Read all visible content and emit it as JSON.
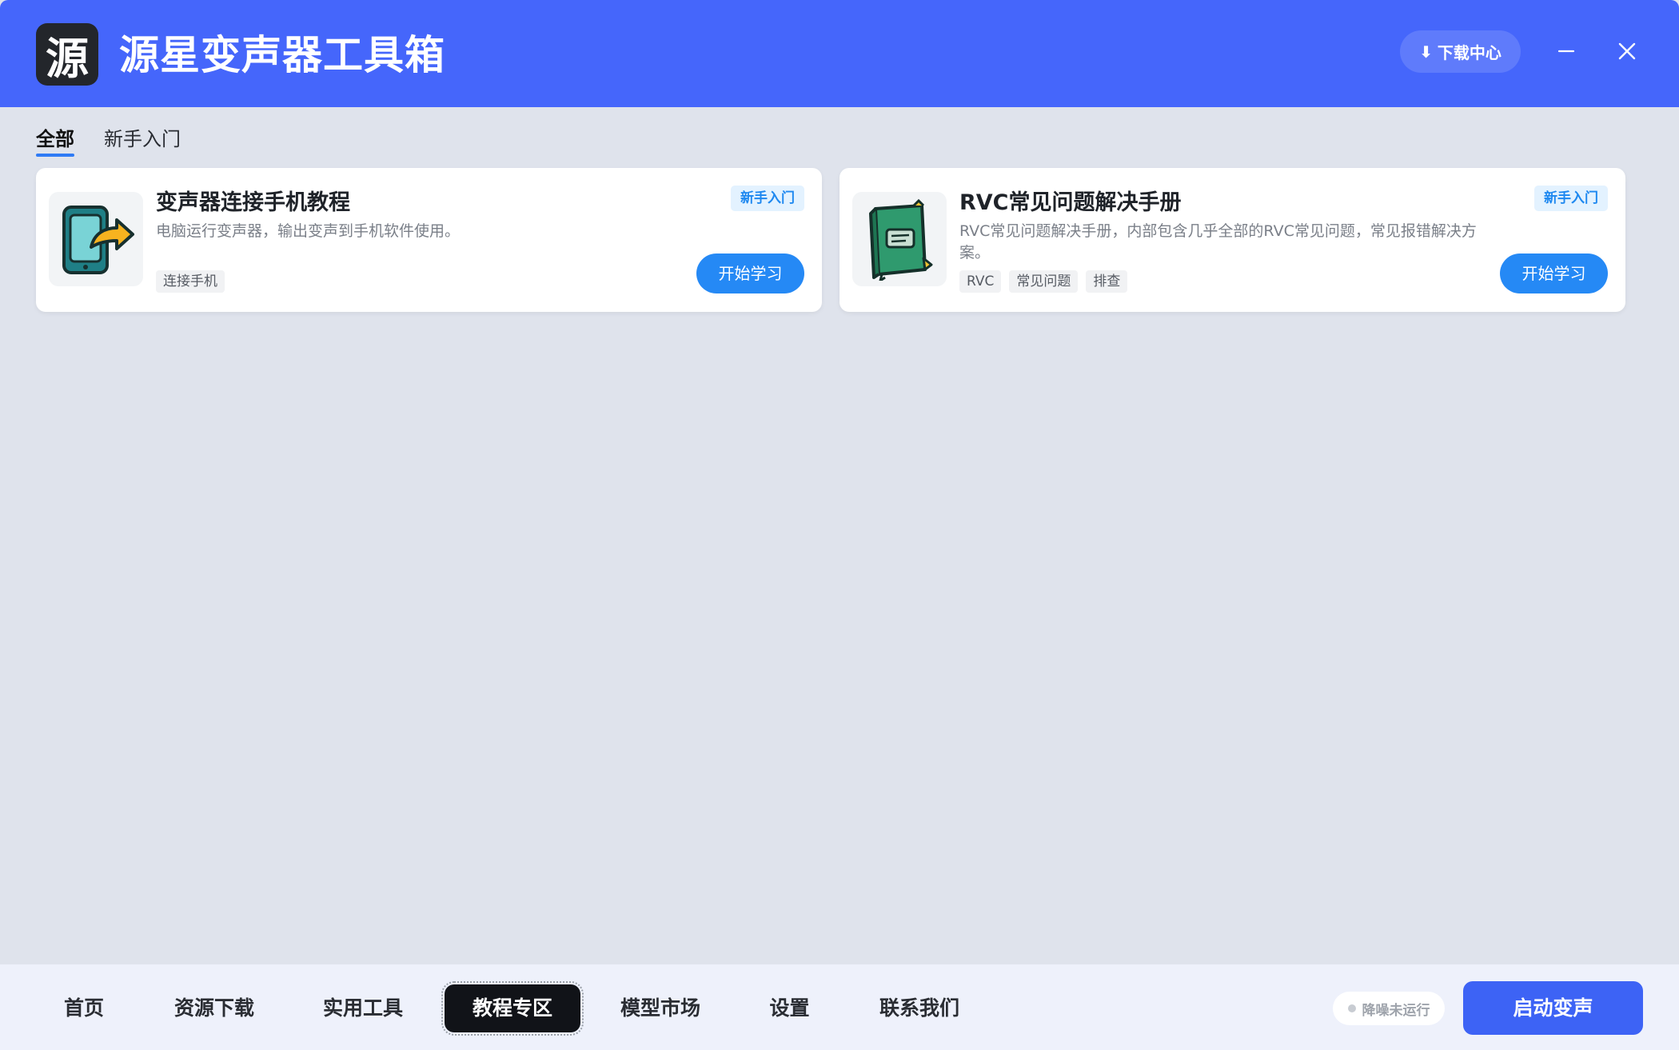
{
  "header": {
    "logo_char": "源",
    "title": "源星变声器工具箱",
    "download_center_label": "下载中心",
    "icons": {
      "download": "download-arrow-icon",
      "minimize": "minimize-icon",
      "close": "close-icon"
    }
  },
  "tabs": [
    {
      "label": "全部",
      "active": true
    },
    {
      "label": "新手入门",
      "active": false
    }
  ],
  "cards": [
    {
      "title": "变声器连接手机教程",
      "description": "电脑运行变声器，输出变声到手机软件使用。",
      "badge": "新手入门",
      "tags": [
        "连接手机"
      ],
      "button_label": "开始学习",
      "icon": "phone-share-icon"
    },
    {
      "title": "RVC常见问题解决手册",
      "description": "RVC常见问题解决手册，内部包含几乎全部的RVC常见问题，常见报错解决方案。",
      "badge": "新手入门",
      "tags": [
        "RVC",
        "常见问题",
        "排查"
      ],
      "button_label": "开始学习",
      "icon": "book-icon"
    }
  ],
  "bottom_nav": {
    "items": [
      {
        "label": "首页",
        "active": false
      },
      {
        "label": "资源下载",
        "active": false
      },
      {
        "label": "实用工具",
        "active": false
      },
      {
        "label": "教程专区",
        "active": true
      },
      {
        "label": "模型市场",
        "active": false
      },
      {
        "label": "设置",
        "active": false
      },
      {
        "label": "联系我们",
        "active": false
      }
    ],
    "noise_status": "降噪未运行",
    "start_button": "启动变声"
  },
  "colors": {
    "header_bg": "#4566fb",
    "page_bg": "#dfe3ec",
    "primary_button": "#2589f5",
    "start_button": "#3d63f5",
    "badge_text": "#1e88f0",
    "active_nav": "#111318"
  }
}
